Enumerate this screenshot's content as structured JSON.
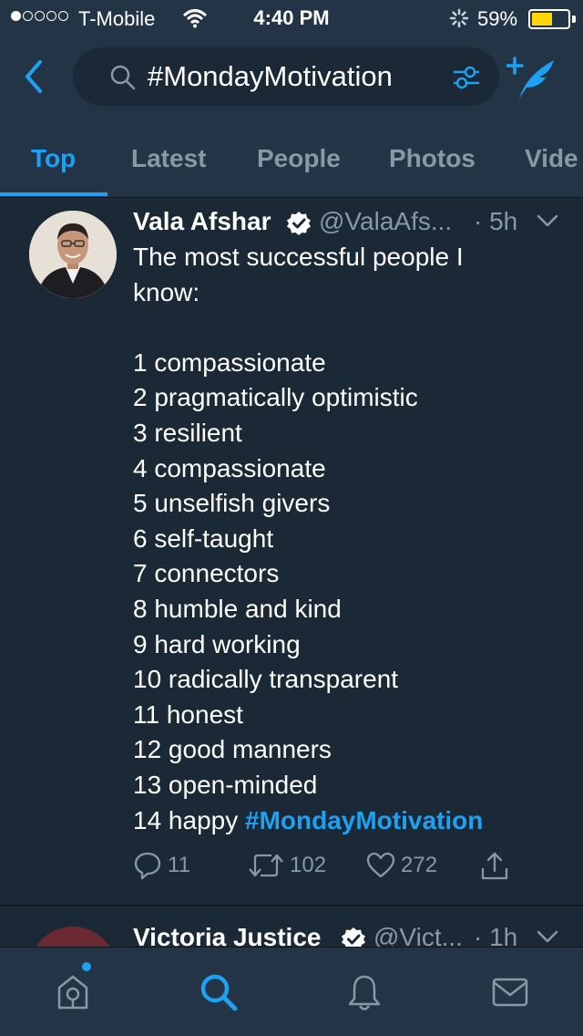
{
  "status_bar": {
    "carrier": "T-Mobile",
    "time": "4:40 PM",
    "battery_percent": "59%",
    "battery_level": 0.59,
    "signal_bars": 1
  },
  "header": {
    "search_query": "#MondayMotivation",
    "tabs": [
      {
        "label": "Top",
        "active": true
      },
      {
        "label": "Latest",
        "active": false
      },
      {
        "label": "People",
        "active": false
      },
      {
        "label": "Photos",
        "active": false
      },
      {
        "label": "Vide",
        "active": false
      }
    ]
  },
  "tweet": {
    "name": "Vala Afshar",
    "handle": "@ValaAfs...",
    "time": "· 5h",
    "lines": [
      "The most successful people I",
      "know:",
      "",
      "1 compassionate",
      "2 pragmatically optimistic",
      "3 resilient",
      "4 compassionate",
      "5 unselfish givers",
      "6 self-taught",
      "7 connectors",
      "8 humble and kind",
      "9 hard working",
      "10 radically transparent",
      "11 honest",
      "12 good manners",
      "13 open-minded"
    ],
    "last_line_text": "14 happy ",
    "hashtag": "#MondayMotivation",
    "reply_count": "11",
    "retweet_count": "102",
    "like_count": "272"
  },
  "next_tweet": {
    "name": "Victoria Justice",
    "handle": "@Vict...",
    "time": "· 1h"
  },
  "colors": {
    "background": "#1b2836",
    "bar": "#243447",
    "accent": "#1da1f2",
    "muted": "#8899a6",
    "battery": "#ffd60a"
  },
  "icons": {
    "back": "chevron-left-icon",
    "search": "search-icon",
    "filter": "filter-sliders-icon",
    "compose": "compose-tweet-icon",
    "verified": "verified-badge-icon",
    "caret": "chevron-down-icon",
    "reply": "reply-icon",
    "retweet": "retweet-icon",
    "like": "heart-icon",
    "share": "share-icon",
    "home": "home-icon",
    "explore": "search-icon",
    "notifications": "bell-icon",
    "messages": "mail-icon"
  }
}
